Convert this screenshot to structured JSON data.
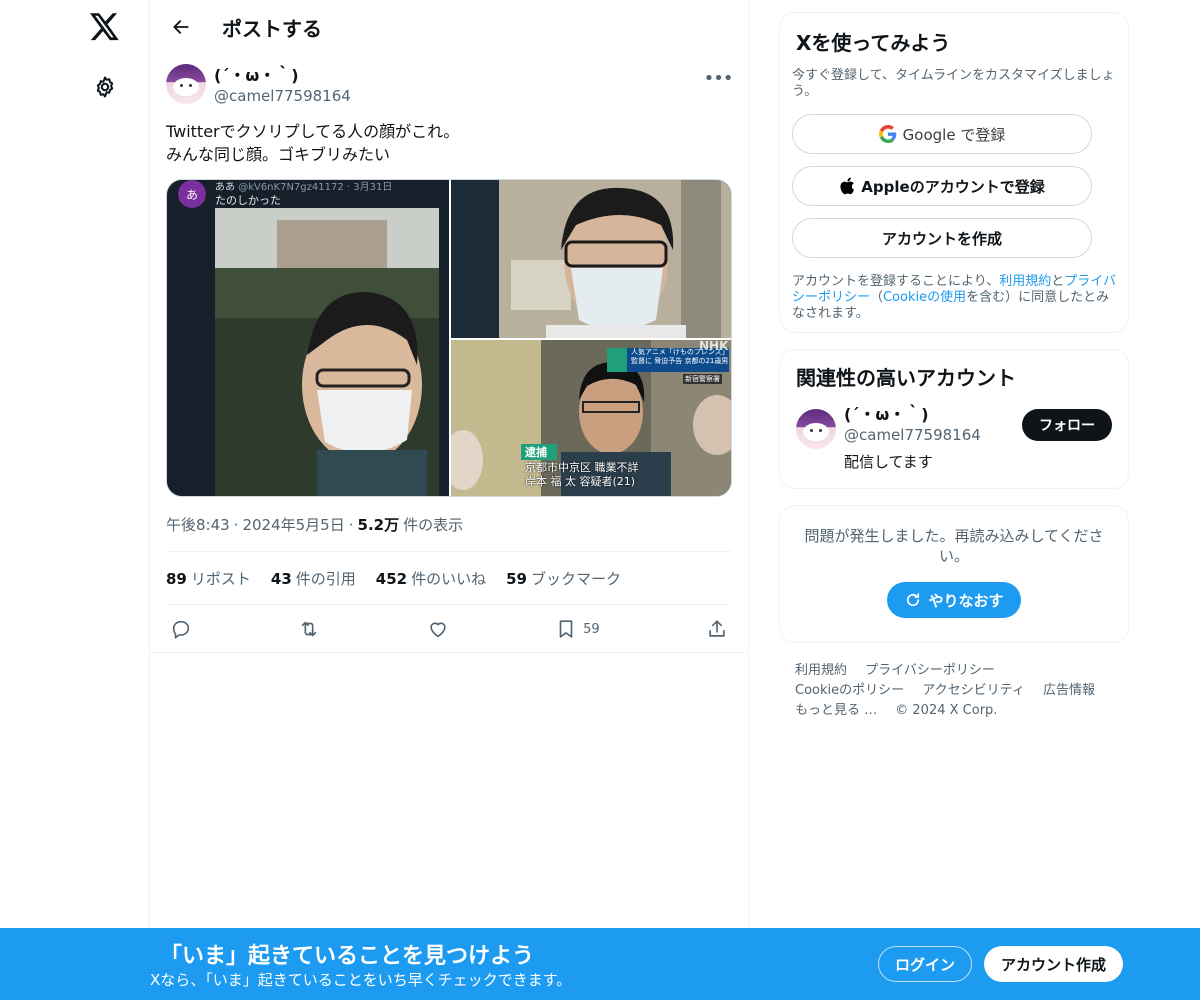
{
  "nav": {
    "logo_icon": "x-logo-icon",
    "settings_icon": "gear-icon"
  },
  "header": {
    "title": "ポストする"
  },
  "tweet": {
    "display_name": "(´・ω・｀)",
    "handle": "@camel77598164",
    "text": "Twitterでクソリプしてる人の顔がこれ。\nみんな同じ顔。ゴキブリみたい",
    "media": {
      "photo1_header_name": "ああ",
      "photo1_header_meta": "@kV6nK7N7gz41172 · 3月31日",
      "photo1_caption": "たのしかった",
      "photo3_ticker": "人気アニメ「けものフレンズ」監督に 脅迫予告 京都の21歳男",
      "photo3_station": "新宿警察署",
      "photo3_badge": "逮捕",
      "photo3_caption_line1": "京都市中京区 職業不詳",
      "photo3_caption_line2": "岸本 福 太 容疑者(21)",
      "photo3_logo": "NHK"
    },
    "meta": {
      "time": "午後8:43",
      "date": "2024年5月5日",
      "views_count": "5.2万",
      "views_label": "件の表示"
    },
    "stats": [
      {
        "count": "89",
        "label": "リポスト"
      },
      {
        "count": "43",
        "label": "件の引用"
      },
      {
        "count": "452",
        "label": "件のいいね"
      },
      {
        "count": "59",
        "label": "ブックマーク"
      }
    ],
    "actions": {
      "bookmark_count": "59"
    }
  },
  "signup": {
    "title": "Xを使ってみよう",
    "subtitle": "今すぐ登録して、タイムラインをカスタマイズしましょう。",
    "google_label": "Google で登録",
    "apple_label": "Appleのアカウントで登録",
    "create_label": "アカウントを作成",
    "terms_pre": "アカウントを登録することにより、",
    "terms_link1": "利用規約",
    "terms_and": "と",
    "terms_link2": "プライバシーポリシー",
    "terms_mid": "（",
    "terms_link3": "Cookieの使用",
    "terms_post": "を含む）に同意したとみなされます。"
  },
  "related": {
    "title": "関連性の高いアカウント",
    "display_name": "(´・ω・｀)",
    "handle": "@camel77598164",
    "bio": "配信してます",
    "follow_label": "フォロー"
  },
  "error": {
    "message": "問題が発生しました。再読み込みしてください。",
    "retry_label": "やりなおす"
  },
  "footer": {
    "links": [
      "利用規約",
      "プライバシーポリシー",
      "Cookieのポリシー",
      "アクセシビリティ",
      "広告情報",
      "もっと見る …"
    ],
    "copyright": "© 2024 X Corp."
  },
  "banner": {
    "title": "「いま」起きていることを見つけよう",
    "subtitle": "Xなら、「いま」起きていることをいち早くチェックできます。",
    "login_label": "ログイン",
    "create_label": "アカウント作成"
  },
  "colors": {
    "accent": "#1d9bf0",
    "text": "#0f1419",
    "secondary": "#536471",
    "border": "#eff3f4"
  }
}
